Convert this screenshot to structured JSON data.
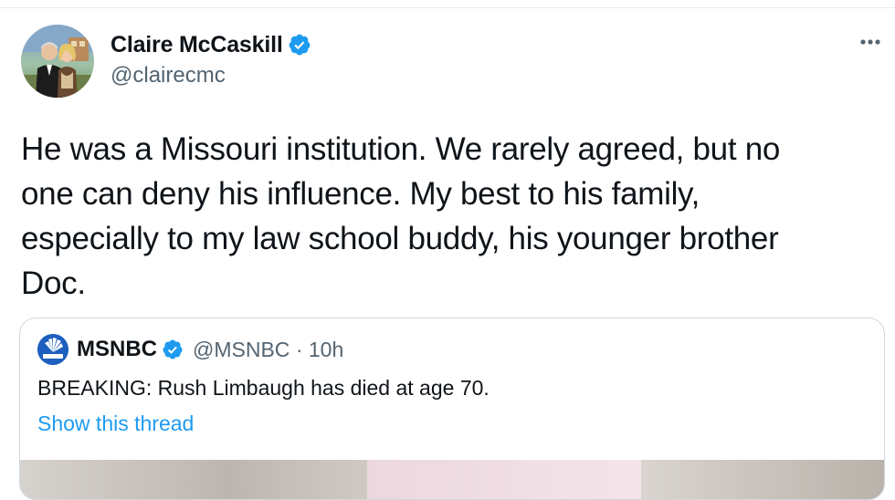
{
  "tweet": {
    "author": {
      "display_name": "Claire McCaskill",
      "handle": "@clairecmc",
      "verified": true,
      "avatar_icon": "profile-photo-couple"
    },
    "more_icon": "ellipsis-icon",
    "text": "He was a Missouri institution. We rarely agreed, but no\none can deny his influence. My best to his family,\nespecially to my law school buddy, his younger brother\nDoc."
  },
  "quoted_tweet": {
    "display_name": "MSNBC",
    "handle": "@MSNBC",
    "separator": "·",
    "time": "10h",
    "verified": true,
    "logo_icon": "msnbc-peacock-logo",
    "text": "BREAKING: Rush Limbaugh has died at age 70.",
    "show_thread_label": "Show this thread"
  },
  "colors": {
    "link": "#1d9bf0",
    "verified": "#1d9bf0",
    "secondary_text": "#536471",
    "border": "#cfd9de"
  }
}
